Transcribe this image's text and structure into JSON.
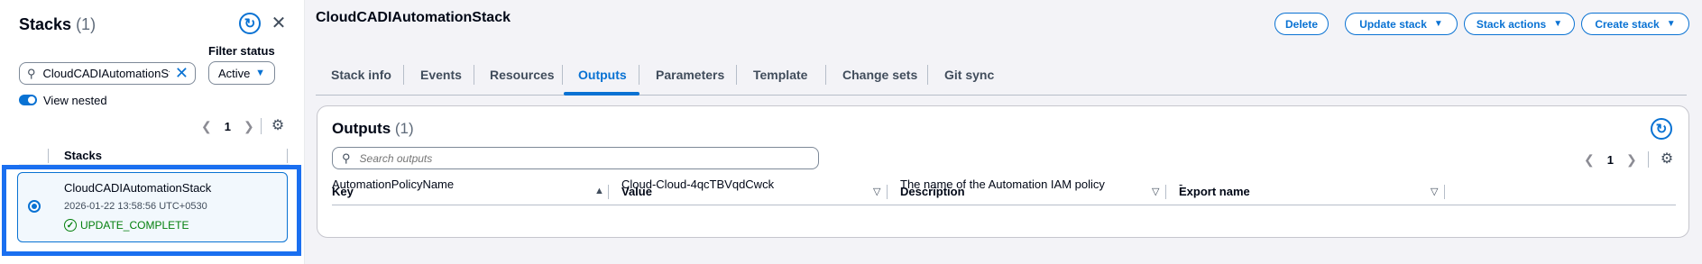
{
  "stacks_panel": {
    "title": "Stacks",
    "count": "(1)",
    "filter_label": "Filter status",
    "search_value": "CloudCADIAutomationSta",
    "filter_value": "Active",
    "view_nested_label": "View nested",
    "page": "1",
    "column_header": "Stacks",
    "selected_stack": {
      "name": "CloudCADIAutomationStack",
      "timestamp": "2026-01-22 13:58:56 UTC+0530",
      "status": "UPDATE_COMPLETE"
    }
  },
  "header": {
    "title": "CloudCADIAutomationStack",
    "buttons": {
      "delete": "Delete",
      "update": "Update stack",
      "actions": "Stack actions",
      "create": "Create stack"
    }
  },
  "tabs": [
    {
      "label": "Stack info"
    },
    {
      "label": "Events"
    },
    {
      "label": "Resources"
    },
    {
      "label": "Outputs"
    },
    {
      "label": "Parameters"
    },
    {
      "label": "Template"
    },
    {
      "label": "Change sets"
    },
    {
      "label": "Git sync"
    }
  ],
  "active_tab": "Outputs",
  "outputs": {
    "title": "Outputs",
    "count": "(1)",
    "search_placeholder": "Search outputs",
    "page": "1",
    "columns": [
      "Key",
      "Value",
      "Description",
      "Export name"
    ],
    "rows": [
      {
        "key": "AutomationPolicyName",
        "value": "Cloud-Cloud-4qcTBVqdCwck",
        "description": "The name of the Automation IAM policy",
        "export_name": "-"
      }
    ]
  },
  "colors": {
    "accent": "#0972d3",
    "success": "#037f0c",
    "highlight_frame": "#1a6ff0"
  },
  "icons": [
    "search-icon",
    "clear-icon",
    "refresh-icon",
    "close-icon",
    "gear-icon",
    "chevron-left-icon",
    "chevron-right-icon",
    "caret-down-icon",
    "success-check-icon",
    "sort-ascending-icon",
    "sort-descending-icon"
  ]
}
